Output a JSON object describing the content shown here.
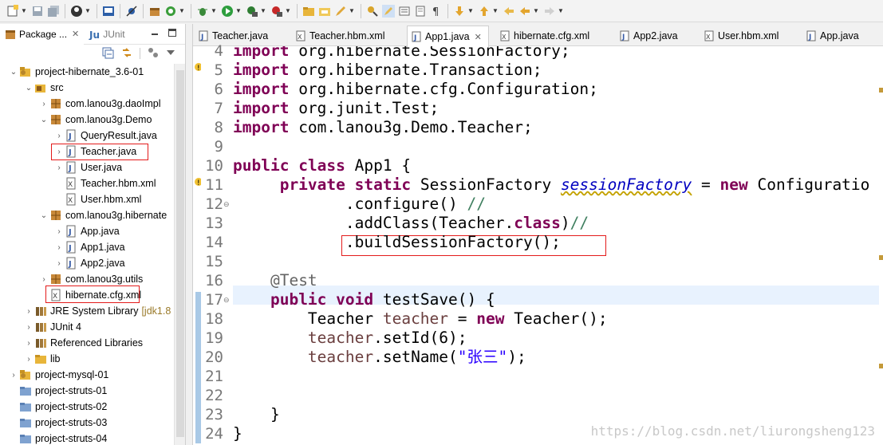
{
  "toolbar": {
    "icons": [
      "new-icon",
      "save-icon",
      "save-all-icon",
      "profile-icon",
      "terminal-icon",
      "skip-breakpoints-icon",
      "new-package-icon",
      "refresh-icon",
      "debug-icon",
      "run-icon",
      "run-server-icon",
      "stop-icon",
      "open-folder-icon",
      "open-type-icon",
      "pen-icon",
      "marker-icon",
      "highlight-icon",
      "toggle-icon",
      "annotate-icon",
      "show-whitespace-icon",
      "next-annotation-icon",
      "prev-annotation-icon",
      "back-icon",
      "forward-icon"
    ]
  },
  "left_panel": {
    "tabs": [
      {
        "label": "Package ...",
        "icon": "package-explorer-icon"
      },
      {
        "label": "JUnit",
        "icon": "junit-icon"
      }
    ],
    "tree": [
      {
        "label": "project-hibernate_3.6-01",
        "icon": "project-icon",
        "expanded": true
      },
      {
        "label": "src",
        "icon": "source-folder-icon",
        "expanded": true
      },
      {
        "label": "com.lanou3g.daoImpl",
        "icon": "package-icon",
        "expanded": false
      },
      {
        "label": "com.lanou3g.Demo",
        "icon": "package-icon",
        "expanded": true
      },
      {
        "label": "QueryResult.java",
        "icon": "java-file-icon",
        "expanded": false
      },
      {
        "label": "Teacher.java",
        "icon": "java-file-icon",
        "expanded": false
      },
      {
        "label": "User.java",
        "icon": "java-file-icon",
        "expanded": false
      },
      {
        "label": "Teacher.hbm.xml",
        "icon": "xml-file-icon"
      },
      {
        "label": "User.hbm.xml",
        "icon": "xml-file-icon"
      },
      {
        "label": "com.lanou3g.hibernate",
        "icon": "package-icon",
        "expanded": true
      },
      {
        "label": "App.java",
        "icon": "java-file-icon",
        "expanded": false
      },
      {
        "label": "App1.java",
        "icon": "java-file-icon",
        "expanded": false
      },
      {
        "label": "App2.java",
        "icon": "java-file-icon",
        "expanded": false
      },
      {
        "label": "com.lanou3g.utils",
        "icon": "package-icon",
        "expanded": false
      },
      {
        "label": "hibernate.cfg.xml",
        "icon": "xml-file-icon"
      },
      {
        "label": "JRE System Library",
        "suffix": "[jdk1.8",
        "icon": "library-icon",
        "expanded": false
      },
      {
        "label": "JUnit 4",
        "icon": "library-icon",
        "expanded": false
      },
      {
        "label": "Referenced Libraries",
        "icon": "library-icon",
        "expanded": false
      },
      {
        "label": "lib",
        "icon": "folder-icon",
        "expanded": false
      },
      {
        "label": "project-mysql-01",
        "icon": "project-icon",
        "expanded": false
      },
      {
        "label": "project-struts-01",
        "icon": "project-icon"
      },
      {
        "label": "project-struts-02",
        "icon": "project-icon"
      },
      {
        "label": "project-struts-03",
        "icon": "project-icon"
      },
      {
        "label": "project-struts-04",
        "icon": "project-icon"
      }
    ]
  },
  "editor": {
    "tabs": [
      {
        "label": "Teacher.java",
        "icon": "java-file-icon",
        "active": false
      },
      {
        "label": "Teacher.hbm.xml",
        "icon": "xml-file-icon",
        "active": false
      },
      {
        "label": "App1.java",
        "icon": "java-file-icon",
        "active": true
      },
      {
        "label": "hibernate.cfg.xml",
        "icon": "xml-file-icon",
        "active": false
      },
      {
        "label": "App2.java",
        "icon": "java-file-icon",
        "active": false
      },
      {
        "label": "User.hbm.xml",
        "icon": "xml-file-icon",
        "active": false
      },
      {
        "label": "App.java",
        "icon": "java-file-icon",
        "active": false
      }
    ],
    "close_glyph": "✕",
    "line_numbers": [
      "4",
      "5",
      "6",
      "7",
      "8",
      "9",
      "10",
      "11",
      "12",
      "13",
      "14",
      "15",
      "16",
      "17",
      "18",
      "19",
      "20",
      "21",
      "22",
      "23",
      "24"
    ],
    "lines": [
      [
        {
          "t": "import",
          "c": "kw"
        },
        {
          "t": " org.hibernate.SessionFactory;"
        }
      ],
      [
        {
          "t": "import",
          "c": "kw"
        },
        {
          "t": " org.hibernate.Transaction;"
        }
      ],
      [
        {
          "t": "import",
          "c": "kw"
        },
        {
          "t": " org.hibernate.cfg.Configuration;"
        }
      ],
      [
        {
          "t": "import",
          "c": "kw"
        },
        {
          "t": " org.junit.Test;"
        }
      ],
      [
        {
          "t": "import",
          "c": "kw"
        },
        {
          "t": " com.lanou3g.Demo.Teacher;"
        }
      ],
      [],
      [
        {
          "t": "public",
          "c": "kw"
        },
        {
          "t": " "
        },
        {
          "t": "class",
          "c": "kw"
        },
        {
          "t": " App1 {"
        }
      ],
      [
        {
          "t": "     "
        },
        {
          "t": "private",
          "c": "kw"
        },
        {
          "t": " "
        },
        {
          "t": "static",
          "c": "kw"
        },
        {
          "t": " SessionFactory "
        },
        {
          "t": "sessionFactory",
          "c": "field"
        },
        {
          "t": " = "
        },
        {
          "t": "new",
          "c": "kw"
        },
        {
          "t": " Configuratio"
        }
      ],
      [
        {
          "t": "            .configure() "
        },
        {
          "t": "//",
          "c": "cmt"
        }
      ],
      [
        {
          "t": "            .addClass(Teacher."
        },
        {
          "t": "class",
          "c": "kw"
        },
        {
          "t": ")"
        },
        {
          "t": "//",
          "c": "cmt"
        }
      ],
      [
        {
          "t": "            .buildSessionFactory();"
        }
      ],
      [],
      [
        {
          "t": "    "
        },
        {
          "t": "@Test",
          "c": "ann"
        }
      ],
      [
        {
          "t": "    "
        },
        {
          "t": "public",
          "c": "kw"
        },
        {
          "t": " "
        },
        {
          "t": "void",
          "c": "kw"
        },
        {
          "t": " testSave() {"
        }
      ],
      [
        {
          "t": "        Teacher "
        },
        {
          "t": "teacher",
          "c": "var"
        },
        {
          "t": " = "
        },
        {
          "t": "new",
          "c": "kw"
        },
        {
          "t": " Teacher();"
        }
      ],
      [
        {
          "t": "        "
        },
        {
          "t": "teacher",
          "c": "var"
        },
        {
          "t": ".setId(6);"
        }
      ],
      [
        {
          "t": "        "
        },
        {
          "t": "teacher",
          "c": "var"
        },
        {
          "t": ".setName("
        },
        {
          "t": "\"张三\"",
          "c": "str"
        },
        {
          "t": ");"
        }
      ],
      [],
      [],
      [
        {
          "t": "    }"
        }
      ],
      [
        {
          "t": "}"
        }
      ]
    ]
  },
  "watermark": "https://blog.csdn.net/liurongsheng123"
}
